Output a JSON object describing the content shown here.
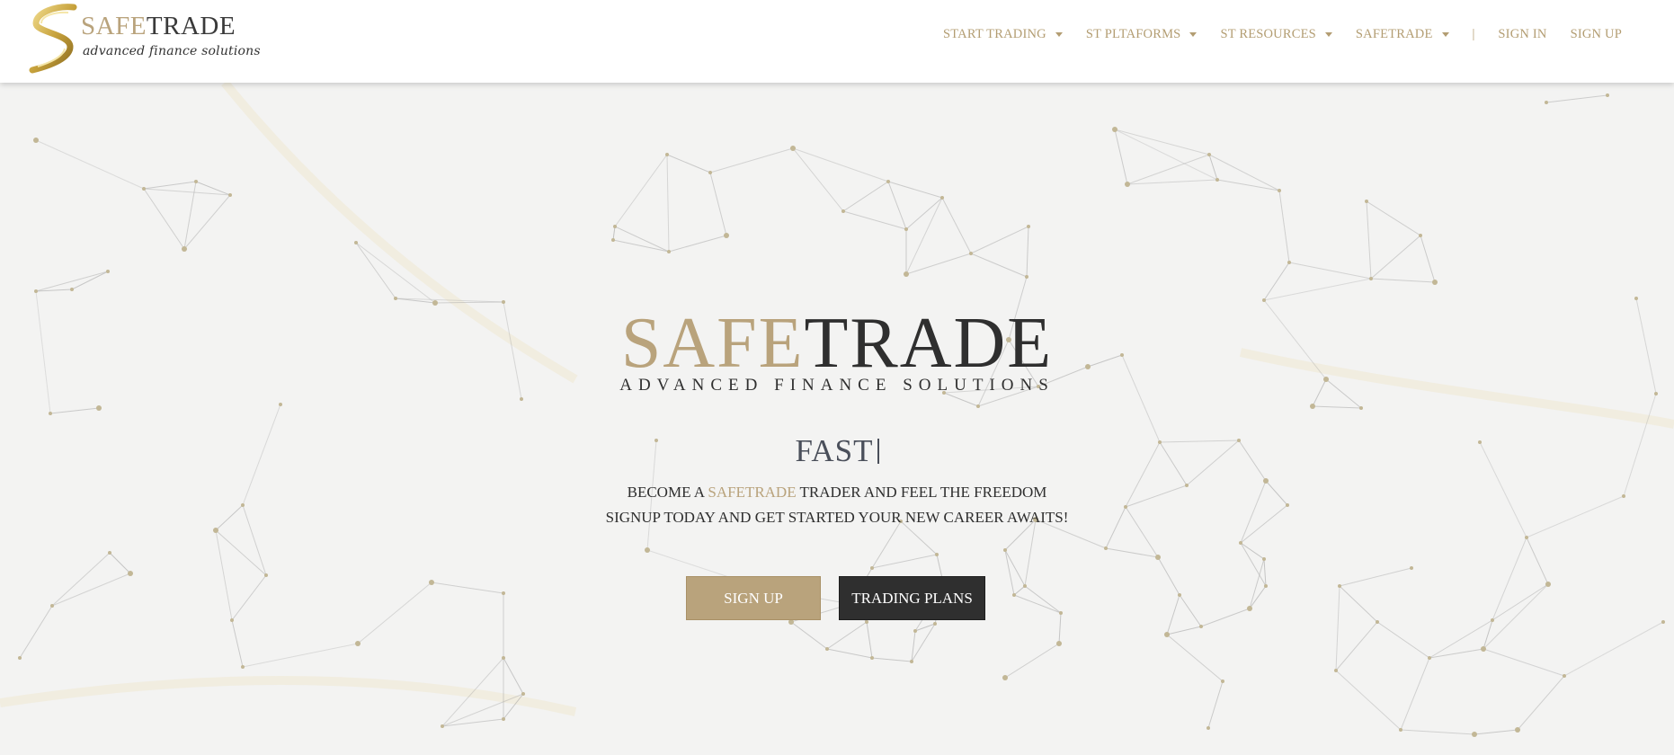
{
  "brand": {
    "logo_safe": "SAFE",
    "logo_trade": "TRADE",
    "logo_tagline": "advanced finance solutions"
  },
  "nav": {
    "items": [
      {
        "label": "START TRADING",
        "dropdown": true
      },
      {
        "label": "ST PLTAFORMS",
        "dropdown": true
      },
      {
        "label": "ST RESOURCES",
        "dropdown": true
      },
      {
        "label": "SAFETRADE",
        "dropdown": true
      }
    ],
    "separator": "|",
    "sign_in": "SIGN IN",
    "sign_up": "SIGN UP"
  },
  "hero": {
    "title_safe": "SAFE",
    "title_trade": "TRADE",
    "subtitle": "ADVANCED FINANCE SOLUTIONS",
    "typed_text": "FAST",
    "line1_prefix": "BECOME A ",
    "line1_brand": "SAFETRADE",
    "line1_suffix": " TRADER AND FEEL THE FREEDOM",
    "line2": "SIGNUP TODAY AND GET STARTED YOUR NEW CAREER AWAITS!",
    "btn_signup": "SIGN UP",
    "btn_plans": "TRADING PLANS"
  },
  "colors": {
    "gold": "#b9a37c",
    "dark": "#2f2f2f",
    "background": "#f3f3f2",
    "nav_text": "#b39d72"
  }
}
